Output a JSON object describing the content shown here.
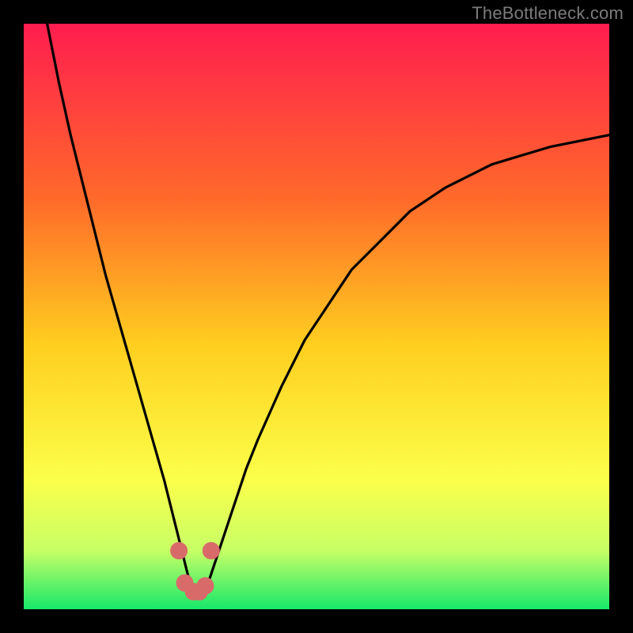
{
  "attribution": "TheBottleneck.com",
  "colors": {
    "gradient_top": "#ff1d4f",
    "gradient_mid1": "#ff6a2a",
    "gradient_mid2": "#ffcf1f",
    "gradient_mid3": "#fbff4a",
    "gradient_mid4": "#c7ff66",
    "gradient_bottom": "#17e86a",
    "curve": "#000000",
    "marker": "#d96a6a",
    "attribution_text": "#7b7b7b",
    "bg": "#000000"
  },
  "chart_data": {
    "type": "line",
    "title": "",
    "xlabel": "",
    "ylabel": "",
    "xlim": [
      0,
      100
    ],
    "ylim": [
      0,
      100
    ],
    "grid": false,
    "legend": false,
    "series": [
      {
        "name": "bottleneck-curve",
        "x": [
          4,
          6,
          8,
          10,
          12,
          14,
          16,
          18,
          20,
          22,
          24,
          25,
          26,
          27,
          28,
          29,
          30,
          31,
          32,
          34,
          36,
          38,
          40,
          44,
          48,
          52,
          56,
          60,
          66,
          72,
          80,
          90,
          100
        ],
        "y": [
          100,
          90,
          81,
          73,
          65,
          57,
          50,
          43,
          36,
          29,
          22,
          18,
          14,
          10,
          6,
          3,
          2,
          3,
          6,
          12,
          18,
          24,
          29,
          38,
          46,
          52,
          58,
          62,
          68,
          72,
          76,
          79,
          81
        ]
      }
    ],
    "markers": [
      {
        "name": "trough-left-cap",
        "x": 26.5,
        "y": 10,
        "color": "#d96a6a"
      },
      {
        "name": "trough-right-cap",
        "x": 32.0,
        "y": 10,
        "color": "#d96a6a"
      },
      {
        "name": "trough-base-a",
        "x": 27.5,
        "y": 4.5,
        "color": "#d96a6a"
      },
      {
        "name": "trough-base-b",
        "x": 29.0,
        "y": 3.0,
        "color": "#d96a6a"
      },
      {
        "name": "trough-base-c",
        "x": 30.0,
        "y": 3.0,
        "color": "#d96a6a"
      },
      {
        "name": "trough-base-d",
        "x": 31.0,
        "y": 4.0,
        "color": "#d96a6a"
      }
    ],
    "annotations": []
  }
}
